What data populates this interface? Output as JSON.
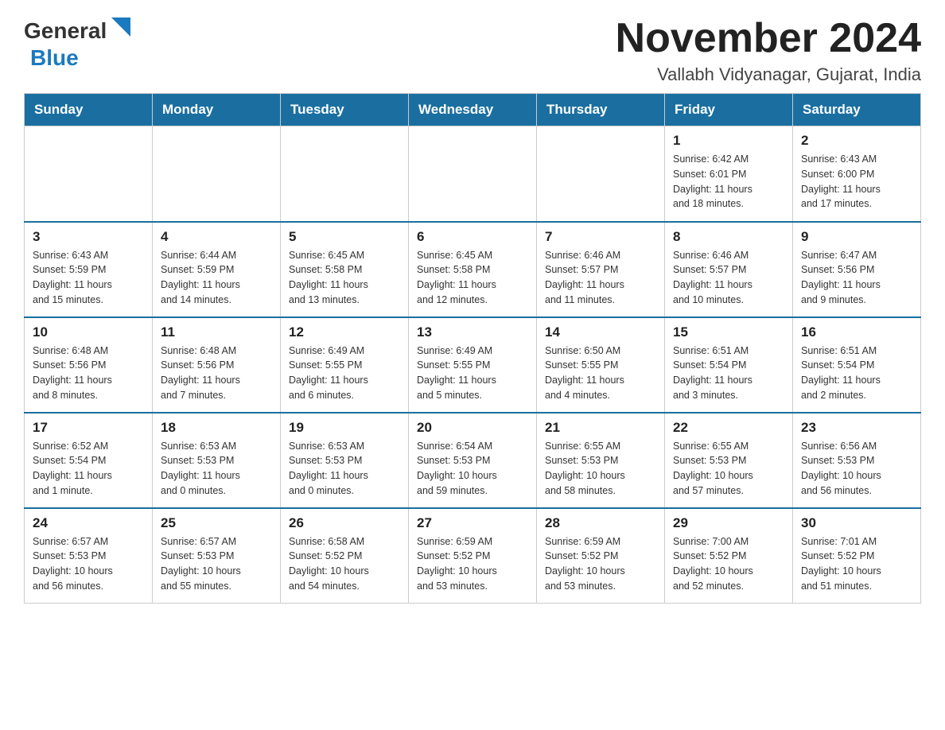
{
  "header": {
    "logo_general": "General",
    "logo_blue": "Blue",
    "month_title": "November 2024",
    "location": "Vallabh Vidyanagar, Gujarat, India"
  },
  "weekdays": [
    "Sunday",
    "Monday",
    "Tuesday",
    "Wednesday",
    "Thursday",
    "Friday",
    "Saturday"
  ],
  "weeks": [
    [
      {
        "day": "",
        "info": ""
      },
      {
        "day": "",
        "info": ""
      },
      {
        "day": "",
        "info": ""
      },
      {
        "day": "",
        "info": ""
      },
      {
        "day": "",
        "info": ""
      },
      {
        "day": "1",
        "info": "Sunrise: 6:42 AM\nSunset: 6:01 PM\nDaylight: 11 hours\nand 18 minutes."
      },
      {
        "day": "2",
        "info": "Sunrise: 6:43 AM\nSunset: 6:00 PM\nDaylight: 11 hours\nand 17 minutes."
      }
    ],
    [
      {
        "day": "3",
        "info": "Sunrise: 6:43 AM\nSunset: 5:59 PM\nDaylight: 11 hours\nand 15 minutes."
      },
      {
        "day": "4",
        "info": "Sunrise: 6:44 AM\nSunset: 5:59 PM\nDaylight: 11 hours\nand 14 minutes."
      },
      {
        "day": "5",
        "info": "Sunrise: 6:45 AM\nSunset: 5:58 PM\nDaylight: 11 hours\nand 13 minutes."
      },
      {
        "day": "6",
        "info": "Sunrise: 6:45 AM\nSunset: 5:58 PM\nDaylight: 11 hours\nand 12 minutes."
      },
      {
        "day": "7",
        "info": "Sunrise: 6:46 AM\nSunset: 5:57 PM\nDaylight: 11 hours\nand 11 minutes."
      },
      {
        "day": "8",
        "info": "Sunrise: 6:46 AM\nSunset: 5:57 PM\nDaylight: 11 hours\nand 10 minutes."
      },
      {
        "day": "9",
        "info": "Sunrise: 6:47 AM\nSunset: 5:56 PM\nDaylight: 11 hours\nand 9 minutes."
      }
    ],
    [
      {
        "day": "10",
        "info": "Sunrise: 6:48 AM\nSunset: 5:56 PM\nDaylight: 11 hours\nand 8 minutes."
      },
      {
        "day": "11",
        "info": "Sunrise: 6:48 AM\nSunset: 5:56 PM\nDaylight: 11 hours\nand 7 minutes."
      },
      {
        "day": "12",
        "info": "Sunrise: 6:49 AM\nSunset: 5:55 PM\nDaylight: 11 hours\nand 6 minutes."
      },
      {
        "day": "13",
        "info": "Sunrise: 6:49 AM\nSunset: 5:55 PM\nDaylight: 11 hours\nand 5 minutes."
      },
      {
        "day": "14",
        "info": "Sunrise: 6:50 AM\nSunset: 5:55 PM\nDaylight: 11 hours\nand 4 minutes."
      },
      {
        "day": "15",
        "info": "Sunrise: 6:51 AM\nSunset: 5:54 PM\nDaylight: 11 hours\nand 3 minutes."
      },
      {
        "day": "16",
        "info": "Sunrise: 6:51 AM\nSunset: 5:54 PM\nDaylight: 11 hours\nand 2 minutes."
      }
    ],
    [
      {
        "day": "17",
        "info": "Sunrise: 6:52 AM\nSunset: 5:54 PM\nDaylight: 11 hours\nand 1 minute."
      },
      {
        "day": "18",
        "info": "Sunrise: 6:53 AM\nSunset: 5:53 PM\nDaylight: 11 hours\nand 0 minutes."
      },
      {
        "day": "19",
        "info": "Sunrise: 6:53 AM\nSunset: 5:53 PM\nDaylight: 11 hours\nand 0 minutes."
      },
      {
        "day": "20",
        "info": "Sunrise: 6:54 AM\nSunset: 5:53 PM\nDaylight: 10 hours\nand 59 minutes."
      },
      {
        "day": "21",
        "info": "Sunrise: 6:55 AM\nSunset: 5:53 PM\nDaylight: 10 hours\nand 58 minutes."
      },
      {
        "day": "22",
        "info": "Sunrise: 6:55 AM\nSunset: 5:53 PM\nDaylight: 10 hours\nand 57 minutes."
      },
      {
        "day": "23",
        "info": "Sunrise: 6:56 AM\nSunset: 5:53 PM\nDaylight: 10 hours\nand 56 minutes."
      }
    ],
    [
      {
        "day": "24",
        "info": "Sunrise: 6:57 AM\nSunset: 5:53 PM\nDaylight: 10 hours\nand 56 minutes."
      },
      {
        "day": "25",
        "info": "Sunrise: 6:57 AM\nSunset: 5:53 PM\nDaylight: 10 hours\nand 55 minutes."
      },
      {
        "day": "26",
        "info": "Sunrise: 6:58 AM\nSunset: 5:52 PM\nDaylight: 10 hours\nand 54 minutes."
      },
      {
        "day": "27",
        "info": "Sunrise: 6:59 AM\nSunset: 5:52 PM\nDaylight: 10 hours\nand 53 minutes."
      },
      {
        "day": "28",
        "info": "Sunrise: 6:59 AM\nSunset: 5:52 PM\nDaylight: 10 hours\nand 53 minutes."
      },
      {
        "day": "29",
        "info": "Sunrise: 7:00 AM\nSunset: 5:52 PM\nDaylight: 10 hours\nand 52 minutes."
      },
      {
        "day": "30",
        "info": "Sunrise: 7:01 AM\nSunset: 5:52 PM\nDaylight: 10 hours\nand 51 minutes."
      }
    ]
  ]
}
